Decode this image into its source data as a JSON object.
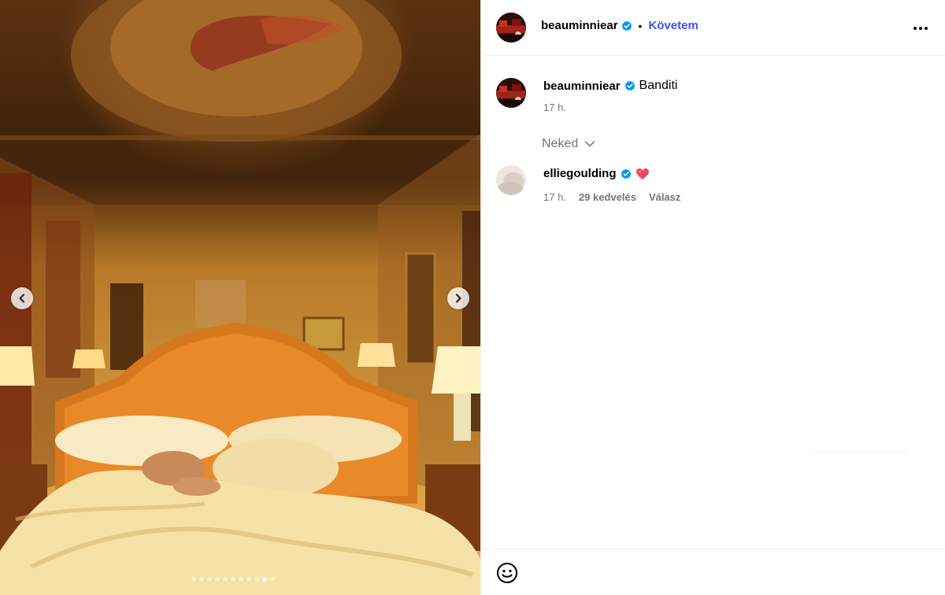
{
  "media": {
    "image_description_icon": "photo-bedroom",
    "prev_icon": "chevron-left-icon",
    "next_icon": "chevron-right-icon",
    "carousel": {
      "total": 11,
      "active_index": 9
    }
  },
  "header": {
    "username": "beauminniear",
    "verified": true,
    "separator": "•",
    "follow_label": "Követem",
    "more_icon": "more-horizontal-icon"
  },
  "post": {
    "username": "beauminniear",
    "caption": "Banditi",
    "time": "17 h."
  },
  "comments_filter": {
    "label": "Neked",
    "icon": "chevron-down-icon"
  },
  "comments": [
    {
      "username": "elliegoulding",
      "text": "❤",
      "time": "17 h.",
      "likes": "29 kedvelés",
      "reply_label": "Válasz"
    }
  ],
  "compose": {
    "emoji_icon": "smiley-icon"
  },
  "colors": {
    "accent": "#4150f7",
    "verified": "#0095f6",
    "heart": "#ed4956",
    "muted": "#737373"
  }
}
